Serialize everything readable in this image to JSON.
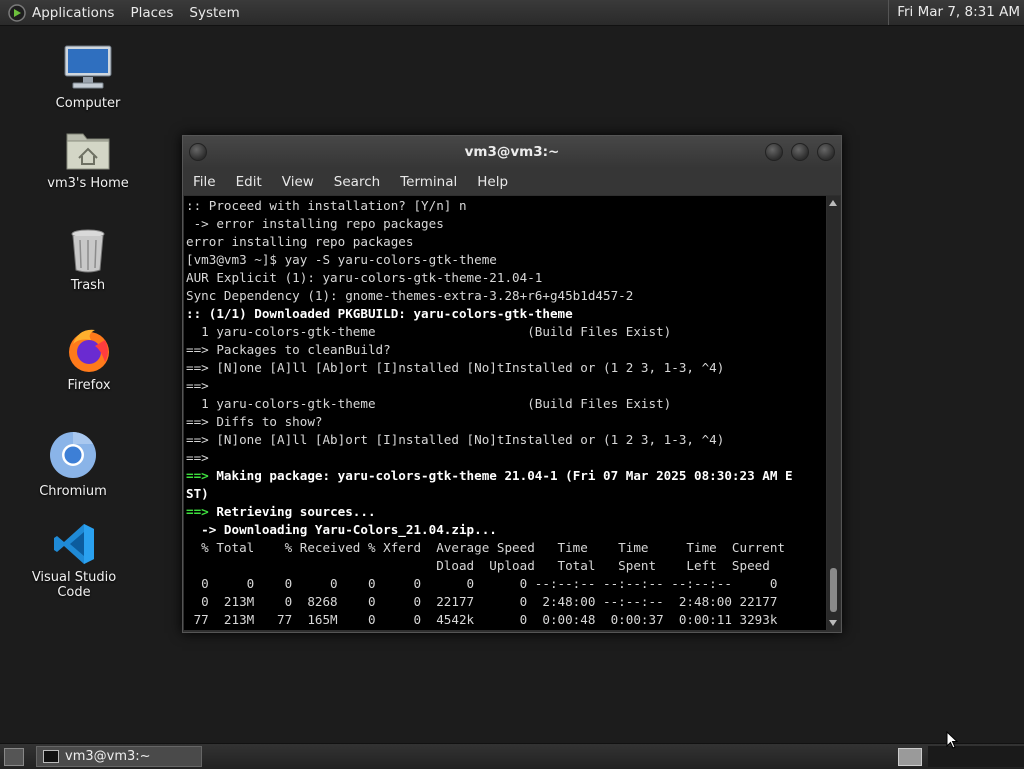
{
  "top_panel": {
    "menus": [
      "Applications",
      "Places",
      "System"
    ],
    "clock": "Fri Mar 7,  8:31 AM"
  },
  "desktop": {
    "icons": [
      {
        "label": "Computer"
      },
      {
        "label": "vm3's Home"
      },
      {
        "label": "Trash"
      },
      {
        "label": "Firefox"
      },
      {
        "label": "Chromium"
      },
      {
        "label": "Visual Studio Code"
      }
    ]
  },
  "window": {
    "title": "vm3@vm3:~",
    "menus": [
      "File",
      "Edit",
      "View",
      "Search",
      "Terminal",
      "Help"
    ],
    "terminal_lines": [
      {
        "t": ":: Proceed with installation? [Y/n] n",
        "s": ""
      },
      {
        "t": " -> error installing repo packages",
        "s": ""
      },
      {
        "t": "error installing repo packages",
        "s": ""
      },
      {
        "t": "[vm3@vm3 ~]$ yay -S yaru-colors-gtk-theme",
        "s": ""
      },
      {
        "t": "AUR Explicit (1): yaru-colors-gtk-theme-21.04-1",
        "s": ""
      },
      {
        "t": "Sync Dependency (1): gnome-themes-extra-3.28+r6+g45b1d457-2",
        "s": ""
      },
      {
        "t": ":: (1/1) Downloaded PKGBUILD: yaru-colors-gtk-theme",
        "s": "b"
      },
      {
        "t": "  1 yaru-colors-gtk-theme                    (Build Files Exist)",
        "s": ""
      },
      {
        "t": "==> Packages to cleanBuild?",
        "s": ""
      },
      {
        "t": "==> [N]one [A]ll [Ab]ort [I]nstalled [No]tInstalled or (1 2 3, 1-3, ^4)",
        "s": ""
      },
      {
        "t": "==>",
        "s": ""
      },
      {
        "t": "  1 yaru-colors-gtk-theme                    (Build Files Exist)",
        "s": ""
      },
      {
        "t": "==> Diffs to show?",
        "s": ""
      },
      {
        "t": "==> [N]one [A]ll [Ab]ort [I]nstalled [No]tInstalled or (1 2 3, 1-3, ^4)",
        "s": ""
      },
      {
        "t": "==>",
        "s": ""
      },
      {
        "t": "==> Making package: yaru-colors-gtk-theme 21.04-1 (Fri 07 Mar 2025 08:30:23 AM E",
        "s": "gb"
      },
      {
        "t": "ST)",
        "s": "b"
      },
      {
        "t": "==> Retrieving sources...",
        "s": "gb"
      },
      {
        "t": "  -> Downloading Yaru-Colors_21.04.zip...",
        "s": "b"
      },
      {
        "t": "  % Total    % Received % Xferd  Average Speed   Time    Time     Time  Current",
        "s": ""
      },
      {
        "t": "                                 Dload  Upload   Total   Spent    Left  Speed",
        "s": ""
      },
      {
        "t": "  0     0    0     0    0     0      0      0 --:--:-- --:--:-- --:--:--     0",
        "s": ""
      },
      {
        "t": "  0  213M    0  8268    0     0  22177      0  2:48:00 --:--:--  2:48:00 22177",
        "s": ""
      },
      {
        "t": " 77  213M   77  165M    0     0  4542k      0  0:00:48  0:00:37  0:00:11 3293k",
        "s": ""
      }
    ]
  },
  "taskbar": {
    "task_label": "vm3@vm3:~"
  }
}
